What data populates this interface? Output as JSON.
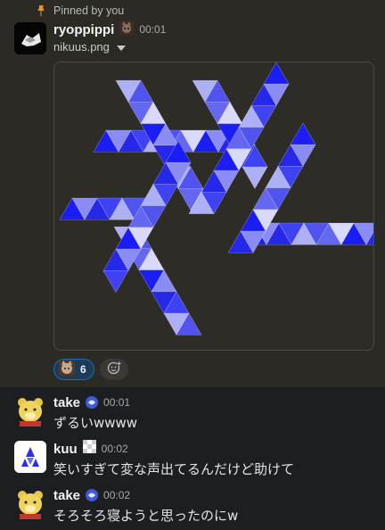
{
  "pinned": {
    "label": "Pinned by you",
    "icon": "pin-icon",
    "author": "ryoppippi",
    "time": "00:01",
    "file_name": "nikuus.png",
    "reaction": {
      "icon": "cat-emoji-icon",
      "count": "6"
    },
    "add_reaction_icon": "add-reaction-icon"
  },
  "messages": [
    {
      "author": "take",
      "time": "00:01",
      "text": "ずるいwwww"
    },
    {
      "author": "kuu",
      "time": "00:02",
      "text": "笑いすぎて変な声出てるんだけど助けて"
    },
    {
      "author": "take",
      "time": "00:02",
      "text": "そろそろ寝ようと思ったのにw"
    }
  ],
  "colors": {
    "pinned_bg": "#2b2a24",
    "channel_bg": "#1d1e21",
    "logo_blue": "#2a2cf0",
    "reaction_border": "#1d6fb5"
  }
}
